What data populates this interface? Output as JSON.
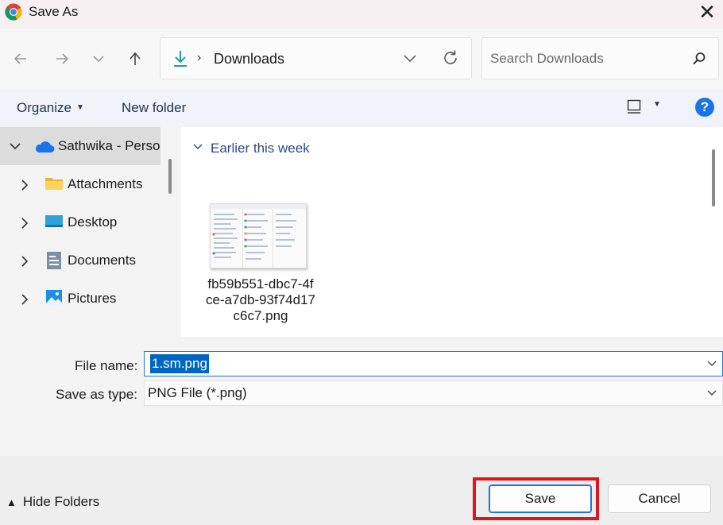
{
  "window": {
    "title": "Save As",
    "close_glyph": "✕",
    "app_icon": "chrome-icon"
  },
  "nav": {
    "back_icon": "arrow-left-icon",
    "forward_icon": "arrow-right-icon",
    "recent_icon": "chevron-down-icon",
    "up_icon": "arrow-up-icon",
    "address": {
      "folder_icon": "download-icon",
      "separator": "›",
      "path": "Downloads"
    },
    "search": {
      "placeholder": "Search Downloads"
    }
  },
  "commandbar": {
    "organize": "Organize",
    "new_folder": "New folder",
    "help": "?"
  },
  "sidebar": {
    "items": [
      {
        "label": "Sathwika - Perso",
        "icon": "onedrive-cloud-icon",
        "expanded": true,
        "selected": true
      },
      {
        "label": "Attachments",
        "icon": "folder-icon"
      },
      {
        "label": "Desktop",
        "icon": "desktop-icon"
      },
      {
        "label": "Documents",
        "icon": "documents-icon"
      },
      {
        "label": "Pictures",
        "icon": "pictures-icon"
      }
    ]
  },
  "content": {
    "group_title": "Earlier this week",
    "files": [
      {
        "name": "fb59b551-dbc7-4fce-a7db-93f74d17c6c7.png",
        "icon": "image-thumbnail"
      }
    ]
  },
  "form": {
    "file_name_label": "File name:",
    "file_name_value": "1.sm.png",
    "type_label": "Save as type:",
    "type_value": "PNG File (*.png)"
  },
  "footer": {
    "hide_folders": "Hide Folders",
    "save": "Save",
    "cancel": "Cancel"
  },
  "colors": {
    "accent": "#1a73e8",
    "selection": "#0067c0",
    "highlight_box": "#e0141e",
    "group_title": "#2b4a8c"
  }
}
